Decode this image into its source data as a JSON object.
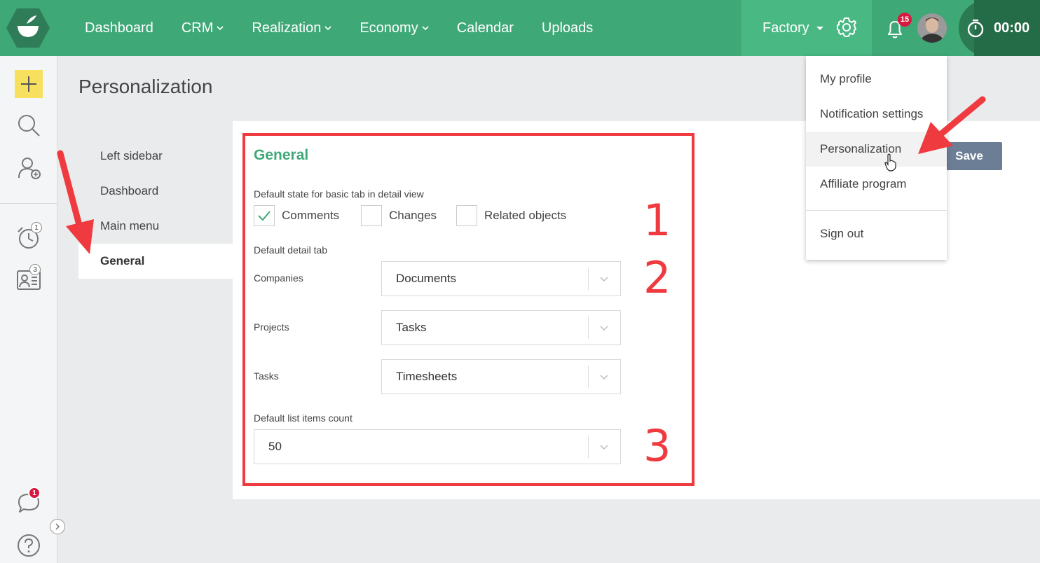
{
  "nav": {
    "items": [
      {
        "label": "Dashboard",
        "dropdown": false
      },
      {
        "label": "CRM",
        "dropdown": true
      },
      {
        "label": "Realization",
        "dropdown": true
      },
      {
        "label": "Economy",
        "dropdown": true
      },
      {
        "label": "Calendar",
        "dropdown": false
      },
      {
        "label": "Uploads",
        "dropdown": false
      }
    ],
    "workspace": "Factory",
    "notifications_count": "15",
    "timer": "00:00"
  },
  "sidebar": {
    "icons": [
      "plus-icon",
      "search-icon",
      "add-contact-icon",
      "alarm-clock-icon",
      "contact-card-icon",
      "chat-icon",
      "help-icon"
    ],
    "alarm_badge": "1",
    "contacts_badge": "3",
    "chat_badge": "1"
  },
  "page": {
    "title": "Personalization",
    "save_label": "Save"
  },
  "subnav": {
    "items": [
      "Left sidebar",
      "Dashboard",
      "Main menu",
      "General"
    ],
    "active": "General"
  },
  "general": {
    "title": "General",
    "tab_state_label": "Default state for basic tab in detail view",
    "checkboxes": [
      {
        "label": "Comments",
        "checked": true
      },
      {
        "label": "Changes",
        "checked": false
      },
      {
        "label": "Related objects",
        "checked": false
      }
    ],
    "detail_tab_label": "Default detail tab",
    "fields": [
      {
        "label": "Companies",
        "value": "Documents"
      },
      {
        "label": "Projects",
        "value": "Tasks"
      },
      {
        "label": "Tasks",
        "value": "Timesheets"
      }
    ],
    "list_count_label": "Default list items count",
    "list_count_value": "50"
  },
  "annotations": {
    "numbers": [
      "1",
      "2",
      "3"
    ],
    "color": "#ef3b3f"
  },
  "user_menu": {
    "items": [
      "My profile",
      "Notification settings",
      "Personalization",
      "Affiliate program",
      "Sign out"
    ],
    "hovered": "Personalization"
  },
  "colors": {
    "brand": "#3fa877",
    "accent_yellow": "#f6e05e",
    "badge_red": "#d7193f",
    "save_button": "#6c7e96"
  }
}
